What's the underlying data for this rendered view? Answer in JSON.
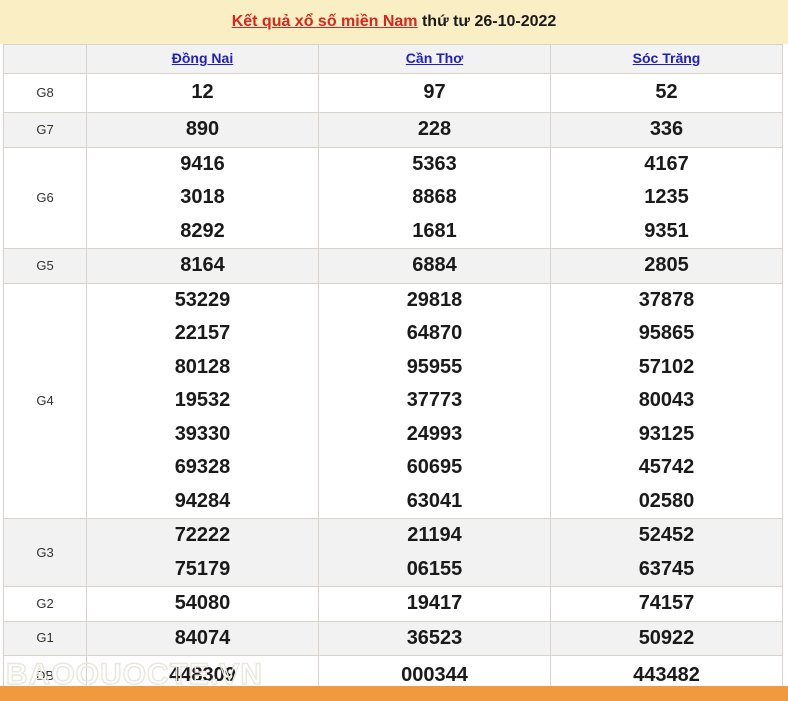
{
  "header": {
    "title_main": "Kết quả xổ số miền Nam",
    "title_date": "thứ tư 26-10-2022",
    "banner_color": "#faeec4",
    "title_color": "#d9261c"
  },
  "table": {
    "corner_label": "",
    "provinces": [
      "Đồng Nai",
      "Cần Thơ",
      "Sóc Trăng"
    ],
    "province_color": "#2020c0",
    "special_color": "#e8342c",
    "rows": [
      {
        "label": "G8",
        "style": "red-large",
        "values": [
          [
            "12"
          ],
          [
            "97"
          ],
          [
            "52"
          ]
        ]
      },
      {
        "label": "G7",
        "style": "black",
        "values": [
          [
            "890"
          ],
          [
            "228"
          ],
          [
            "336"
          ]
        ]
      },
      {
        "label": "G6",
        "style": "black",
        "values": [
          [
            "9416",
            "3018",
            "8292"
          ],
          [
            "5363",
            "8868",
            "1681"
          ],
          [
            "4167",
            "1235",
            "9351"
          ]
        ]
      },
      {
        "label": "G5",
        "style": "black",
        "values": [
          [
            "8164"
          ],
          [
            "6884"
          ],
          [
            "2805"
          ]
        ]
      },
      {
        "label": "G4",
        "style": "black",
        "values": [
          [
            "53229",
            "22157",
            "80128",
            "19532",
            "39330",
            "69328",
            "94284"
          ],
          [
            "29818",
            "64870",
            "95955",
            "37773",
            "24993",
            "60695",
            "63041"
          ],
          [
            "37878",
            "95865",
            "57102",
            "80043",
            "93125",
            "45742",
            "02580"
          ]
        ]
      },
      {
        "label": "G3",
        "style": "black",
        "values": [
          [
            "72222",
            "75179"
          ],
          [
            "21194",
            "06155"
          ],
          [
            "52452",
            "63745"
          ]
        ]
      },
      {
        "label": "G2",
        "style": "black",
        "values": [
          [
            "54080"
          ],
          [
            "19417"
          ],
          [
            "74157"
          ]
        ]
      },
      {
        "label": "G1",
        "style": "black",
        "values": [
          [
            "84074"
          ],
          [
            "36523"
          ],
          [
            "50922"
          ]
        ]
      },
      {
        "label": "ĐB",
        "style": "red-large",
        "values": [
          [
            "448309"
          ],
          [
            "000344"
          ],
          [
            "443482"
          ]
        ]
      }
    ]
  },
  "watermark": {
    "text": "BAOQUOCTE.VN"
  },
  "footer": {
    "bar_color": "#f0993e"
  }
}
